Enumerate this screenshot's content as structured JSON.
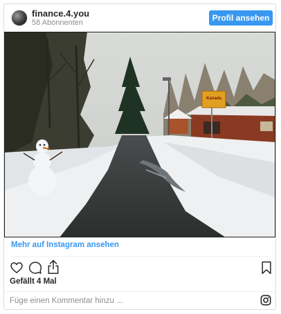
{
  "header": {
    "username": "finance.4.you",
    "followers": "58 Abonnenten",
    "profile_button": "Profil ansehen"
  },
  "photo": {
    "sign_text": "Kanada",
    "icon": "post-photo"
  },
  "link": {
    "label": "Mehr auf Instagram ansehen"
  },
  "actions": {
    "icons": [
      "heart-icon",
      "comment-icon",
      "share-icon",
      "bookmark-icon"
    ]
  },
  "likes": {
    "label": "Gefällt 4 Mal"
  },
  "comment": {
    "placeholder": "Füge einen Kommentar hinzu ..."
  },
  "colors": {
    "accent": "#3897f0",
    "text": "#262626",
    "muted": "#8e8e8e",
    "border": "#dbdbdb"
  }
}
